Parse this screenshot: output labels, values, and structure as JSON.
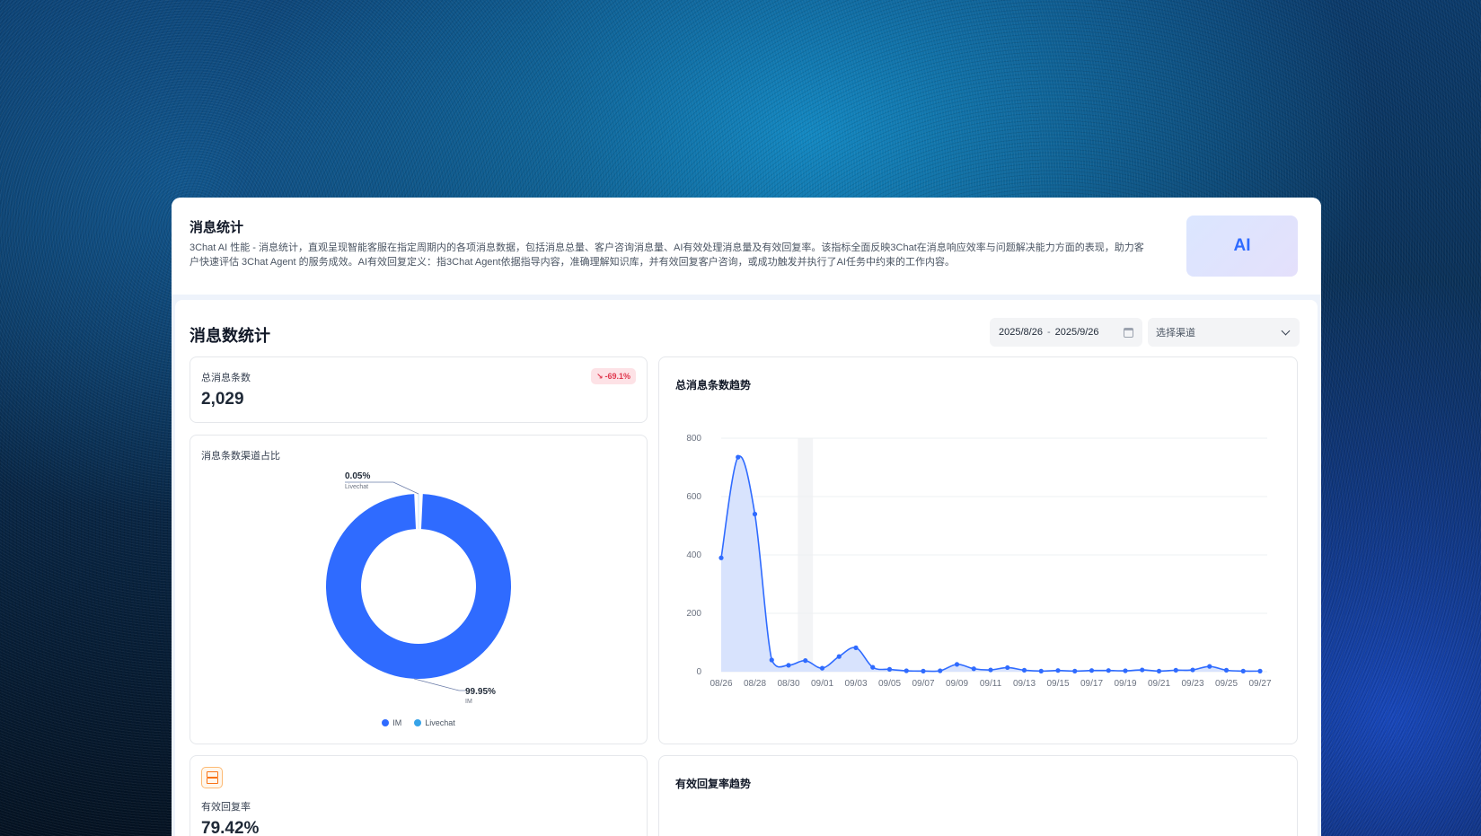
{
  "intro": {
    "title": "消息统计",
    "description": "3Chat AI 性能 - 消息统计，直观呈现智能客服在指定周期内的各项消息数据，包括消息总量、客户咨询消息量、AI有效处理消息量及有效回复率。该指标全面反映3Chat在消息响应效率与问题解决能力方面的表现，助力客户快速评估 3Chat Agent 的服务成效。AI有效回复定义：指3Chat Agent依据指导内容，准确理解知识库，并有效回复客户咨询，或成功触发并执行了AI任务中约束的工作内容。",
    "ai_badge": "AI"
  },
  "section": {
    "title": "消息数统计"
  },
  "filters": {
    "date_start": "2025/8/26",
    "date_sep": "-",
    "date_end": "2025/9/26",
    "channel_placeholder": "选择渠道"
  },
  "total_messages": {
    "label": "总消息条数",
    "value": "2,029",
    "change": "-69.1%",
    "change_direction": "down"
  },
  "channel_share": {
    "title": "消息条数渠道占比"
  },
  "trend": {
    "title": "总消息条数趋势"
  },
  "effective_rate": {
    "label": "有效回复率",
    "value": "79.42%"
  },
  "rate_trend": {
    "title": "有效回复率趋势"
  },
  "colors": {
    "im": "#2f6bff",
    "livechat": "#36a3e8",
    "line": "#2f6bff",
    "area": "#d6e2fd",
    "danger": "#e0384e"
  },
  "chart_data": [
    {
      "type": "pie",
      "title": "消息条数渠道占比",
      "labels": [
        "IM",
        "Livechat"
      ],
      "values": [
        99.95,
        0.05
      ],
      "value_labels": [
        "99.95%",
        "0.05%"
      ],
      "legend": "bottom"
    },
    {
      "type": "area",
      "title": "总消息条数趋势",
      "x": [
        "08/26",
        "08/27",
        "08/28",
        "08/29",
        "08/30",
        "08/31",
        "09/01",
        "09/02",
        "09/03",
        "09/04",
        "09/05",
        "09/06",
        "09/07",
        "09/08",
        "09/09",
        "09/10",
        "09/11",
        "09/12",
        "09/13",
        "09/14",
        "09/15",
        "09/16",
        "09/17",
        "09/18",
        "09/19",
        "09/20",
        "09/21",
        "09/22",
        "09/23",
        "09/24",
        "09/25",
        "09/26",
        "09/27"
      ],
      "x_tick_labels": [
        "08/26",
        "08/28",
        "08/30",
        "09/01",
        "09/03",
        "09/05",
        "09/07",
        "09/09",
        "09/11",
        "09/13",
        "09/15",
        "09/17",
        "09/19",
        "09/21",
        "09/23",
        "09/25",
        "09/27"
      ],
      "series": [
        {
          "values": [
            390,
            735,
            540,
            40,
            22,
            38,
            12,
            52,
            82,
            15,
            8,
            3,
            2,
            3,
            25,
            10,
            6,
            14,
            5,
            2,
            4,
            2,
            4,
            4,
            3,
            6,
            2,
            5,
            6,
            18,
            5,
            2,
            2
          ]
        }
      ],
      "ylim": [
        0,
        800
      ],
      "yticks": [
        0,
        200,
        400,
        600,
        800
      ],
      "grid": true,
      "hover_x": "08/31"
    }
  ]
}
